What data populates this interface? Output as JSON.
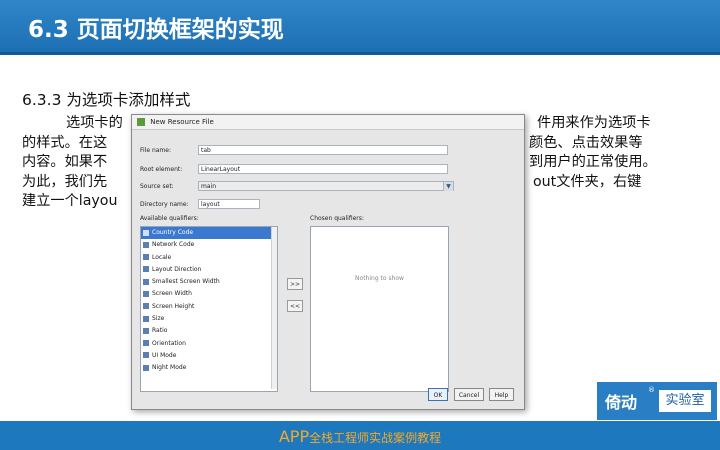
{
  "header": {
    "title": "6.3 页面切换框架的实现"
  },
  "section": {
    "title": "6.3.3  为选项卡添加样式"
  },
  "body": {
    "lines": [
      "选项卡的",
      "的样式。在这",
      "内容。如果不",
      "为此，我们先",
      "建立一个layou"
    ],
    "right_fragments": [
      "件用来作为选项卡",
      "颜色、点击效果等",
      "到用户的正常使用。",
      "out文件夹，右键",
      ""
    ]
  },
  "dialog": {
    "title": "New Resource File",
    "fields": {
      "file_name_label": "File name:",
      "file_name_value": "tab",
      "root_element_label": "Root element:",
      "root_element_value": "LinearLayout",
      "source_set_label": "Source set:",
      "source_set_value": "main",
      "directory_name_label": "Directory name:",
      "directory_name_value": "layout"
    },
    "available_label": "Available qualifiers:",
    "chosen_label": "Chosen qualifiers:",
    "qualifiers": [
      "Country Code",
      "Network Code",
      "Locale",
      "Layout Direction",
      "Smallest Screen Width",
      "Screen Width",
      "Screen Height",
      "Size",
      "Ratio",
      "Orientation",
      "UI Mode",
      "Night Mode"
    ],
    "nothing_to_show": "Nothing to show",
    "add_button": ">>",
    "remove_button": "<<",
    "buttons": {
      "ok": "OK",
      "cancel": "Cancel",
      "help": "Help"
    }
  },
  "logo": {
    "brand": "倚动",
    "lab": "实验室",
    "reg": "®"
  },
  "footer": {
    "app": "APP",
    "rest": "全栈工程师实战案例教程"
  },
  "colors": {
    "header_blue": "#1d6fb3",
    "footer_blue": "#1e78bd",
    "footer_text": "#f2a92c",
    "selection": "#3b78d0"
  }
}
